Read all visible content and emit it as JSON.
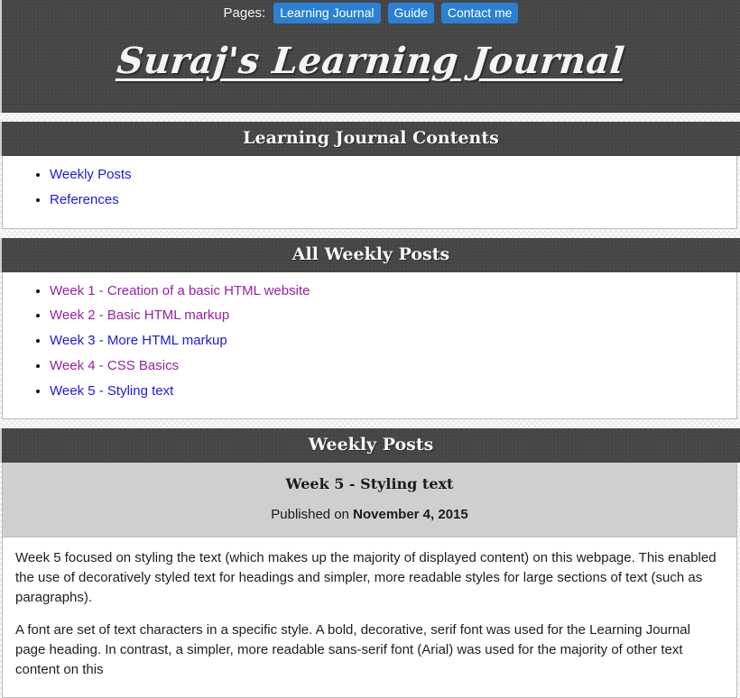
{
  "nav": {
    "label": "Pages:",
    "items": [
      {
        "label": "Learning Journal"
      },
      {
        "label": "Guide"
      },
      {
        "label": "Contact me"
      }
    ]
  },
  "header": {
    "site_title": "Suraj's Learning Journal"
  },
  "contents_section": {
    "heading": "Learning Journal Contents",
    "links": [
      {
        "label": "Weekly Posts",
        "state": "unvisited"
      },
      {
        "label": "References",
        "state": "unvisited"
      }
    ]
  },
  "all_posts_section": {
    "heading": "All Weekly Posts",
    "links": [
      {
        "label": "Week 1 - Creation of a basic HTML website",
        "state": "visited"
      },
      {
        "label": "Week 2 - Basic HTML markup",
        "state": "visited"
      },
      {
        "label": "Week 3 - More HTML markup",
        "state": "unvisited"
      },
      {
        "label": "Week 4 - CSS Basics",
        "state": "visited"
      },
      {
        "label": "Week 5 - Styling text",
        "state": "unvisited"
      }
    ]
  },
  "weekly_posts_section": {
    "heading": "Weekly Posts",
    "post": {
      "title": "Week 5 - Styling text",
      "published_prefix": "Published on ",
      "published_date": "November 4, 2015",
      "paragraphs": [
        "Week 5 focused on styling the text (which makes up the majority of displayed content) on this webpage. This enabled the use of decoratively styled text for headings and simpler, more readable styles for large sections of text (such as paragraphs).",
        "A font are set of text characters in a specific style. A bold, decorative, serif font was used for the Learning Journal page heading. In contrast, a simpler, more readable sans-serif font (Arial) was used for the majority of other text content on this"
      ]
    }
  },
  "colors": {
    "dark_bar": "#454545",
    "nav_button": "#2a81d4",
    "link_unvisited": "#1a1ae0",
    "link_visited": "#9a1fa8",
    "meta_background": "#cfcfcf",
    "page_background": "#ececec"
  }
}
